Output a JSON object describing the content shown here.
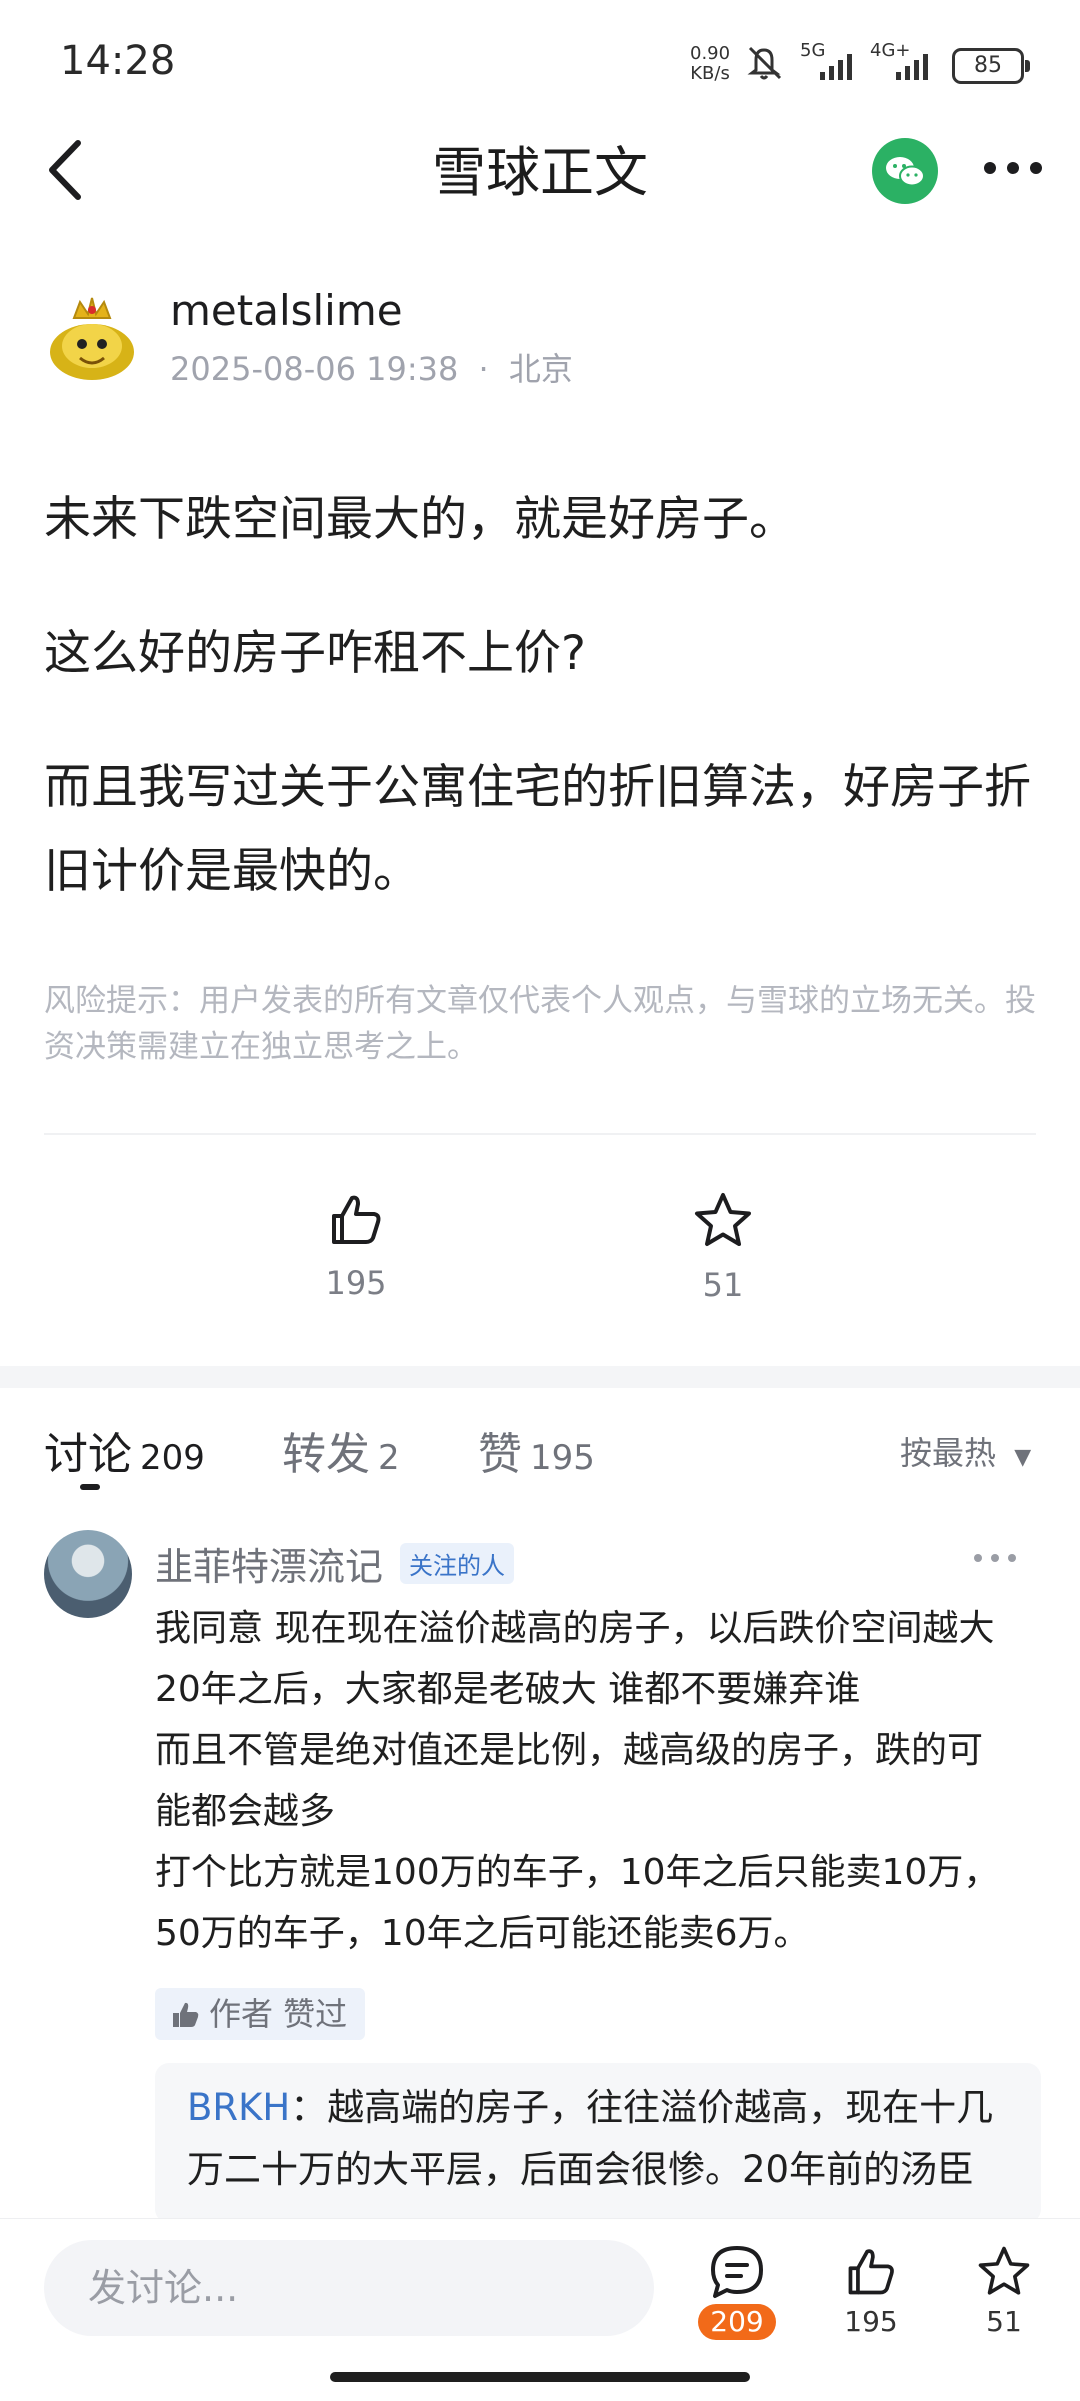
{
  "status_bar": {
    "time": "14:28",
    "net_speed_value": "0.90",
    "net_speed_unit": "KB/s",
    "sig1": "5G",
    "sig2": "4G+",
    "battery": "85"
  },
  "header": {
    "title": "雪球正文",
    "icons": {
      "back": "chevron-left-icon",
      "share": "wechat-icon",
      "more": "more-dots-icon"
    },
    "share_color": "#2bb164"
  },
  "post": {
    "author": "metalslime",
    "date": "2025-08-06 19:38",
    "separator": "·",
    "location": "北京",
    "paragraphs": [
      "未来下跌空间最大的，就是好房子。",
      "这么好的房子咋租不上价?",
      "而且我写过关于公寓住宅的折旧算法，好房子折旧计价是最快的。"
    ],
    "risk_notice": "风险提示：用户发表的所有文章仅代表个人观点，与雪球的立场无关。投资决策需建立在独立思考之上。",
    "likes": "195",
    "favorites": "51"
  },
  "tabs": [
    {
      "label": "讨论",
      "count": "209"
    },
    {
      "label": "转发",
      "count": "2"
    },
    {
      "label": "赞",
      "count": "195"
    }
  ],
  "sort_label": "按最热",
  "comment": {
    "user": "韭菲特漂流记",
    "badge": "关注的人",
    "lines": [
      "我同意 现在现在溢价越高的房子，以后跌价空间越大",
      "20年之后，大家都是老破大 谁都不要嫌弃谁",
      "而且不管是绝对值还是比例，越高级的房子，跌的可",
      "能都会越多",
      "打个比方就是100万的车子，10年之后只能卖10万，",
      "50万的车子，10年之后可能还能卖6万。"
    ],
    "liked_by_author": "作者 赞过",
    "reply_user": "BRKH",
    "reply_colon": "：",
    "reply_text": "越高端的房子，往往溢价越高，现在十几万二十万的大平层，后面会很惨。20年前的汤臣"
  },
  "bottom_bar": {
    "input_placeholder": "发讨论...",
    "comments": "209",
    "likes": "195",
    "favorites": "51",
    "badge_color": "#f26a19"
  }
}
